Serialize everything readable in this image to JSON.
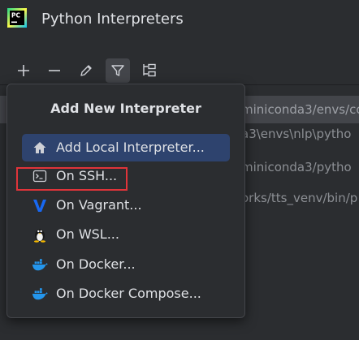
{
  "window": {
    "title": "Python Interpreters",
    "logo_text": "PC"
  },
  "toolbar": {
    "buttons": [
      {
        "icon": "plus-icon",
        "active": false
      },
      {
        "icon": "minus-icon",
        "active": false
      },
      {
        "icon": "pencil-icon",
        "active": false
      },
      {
        "icon": "filter-icon",
        "active": true
      },
      {
        "icon": "tree-view-icon",
        "active": false
      }
    ]
  },
  "interpreter_list": {
    "rows": [
      {
        "text": "miniconda3/envs/co",
        "selected": true
      },
      {
        "text": "a3\\envs\\nlp\\pytho",
        "selected": false
      },
      {
        "text": "miniconda3/pytho",
        "selected": false
      },
      {
        "text": "orks/tts_venv/bin/p",
        "selected": false
      }
    ]
  },
  "popup": {
    "title": "Add New Interpreter",
    "items": [
      {
        "label": "Add Local Interpreter...",
        "icon": "home-icon",
        "selected": true
      },
      {
        "label": "On SSH...",
        "icon": "terminal-icon",
        "selected": false
      },
      {
        "label": "On Vagrant...",
        "icon": "vagrant-icon",
        "selected": false
      },
      {
        "label": "On WSL...",
        "icon": "linux-tux-icon",
        "selected": false
      },
      {
        "label": "On Docker...",
        "icon": "docker-icon",
        "selected": false
      },
      {
        "label": "On Docker Compose...",
        "icon": "docker-icon",
        "selected": false
      }
    ]
  },
  "colors": {
    "background": "#2b2d30",
    "selection": "#2e436e",
    "annotation": "#e0343a",
    "vagrant": "#1868f2",
    "docker": "#2496ed"
  }
}
